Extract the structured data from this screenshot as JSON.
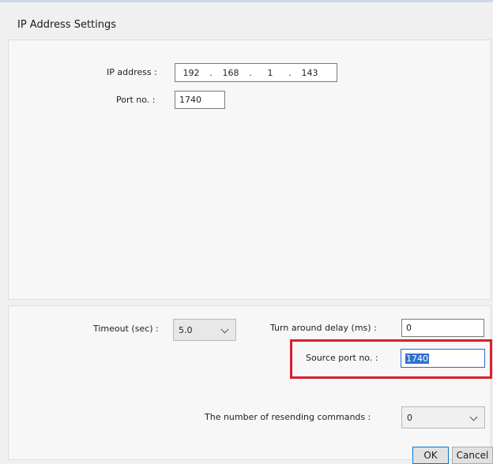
{
  "dialog": {
    "title": "IP Address Settings"
  },
  "ip": {
    "label": "IP address :",
    "octets": [
      "192",
      "168",
      "1",
      "143"
    ],
    "separator": "."
  },
  "port": {
    "label": "Port no. :",
    "value": "1740"
  },
  "timeout": {
    "label": "Timeout (sec) :",
    "value": "5.0"
  },
  "turnaround": {
    "label": "Turn around delay (ms) :",
    "value": "0"
  },
  "source_port": {
    "label": "Source port no. :",
    "value": "1740"
  },
  "resend": {
    "label": "The number of resending commands :",
    "value": "0"
  },
  "buttons": {
    "ok": "OK",
    "cancel": "Cancel"
  },
  "colors": {
    "highlight": "#d8202a",
    "selection": "#3070d0"
  }
}
